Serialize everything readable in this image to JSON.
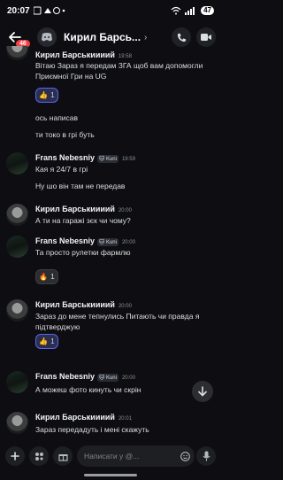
{
  "status_bar": {
    "time": "20:07",
    "battery": "47"
  },
  "header": {
    "back_badge": "46",
    "title": "Кирил Барсь...",
    "chevron": "›"
  },
  "messages": [
    {
      "id": "m1",
      "author": "Кирил Барськиииий",
      "time": "19:58",
      "avatar": "kyryl",
      "lines": [
        "Вітаю Зараз я передам ЗГА щоб вам допомогли Приємної Гри на UG"
      ],
      "reaction": {
        "emoji": "👍",
        "count": "1"
      }
    },
    {
      "id": "m2",
      "lines": [
        "ось написав"
      ]
    },
    {
      "id": "m3",
      "lines": [
        "ти токо в грі буть"
      ]
    },
    {
      "id": "m4",
      "author": "Frans Nebesniy",
      "tag": "Kuni",
      "time": "19:59",
      "avatar": "frans",
      "lines": [
        "Кая я 24/7 в грі"
      ]
    },
    {
      "id": "m5",
      "lines": [
        "Ну шо він там не передав"
      ]
    },
    {
      "id": "m6",
      "author": "Кирил Барськиииий",
      "time": "20:00",
      "avatar": "kyryl",
      "lines": [
        "А ти на гаражі зєк чи чому?"
      ]
    },
    {
      "id": "m7",
      "author": "Frans Nebesniy",
      "tag": "Kuni",
      "time": "20:00",
      "avatar": "frans",
      "lines": [
        "Та просто рулетки фармлю"
      ],
      "reaction": {
        "emoji": "🔥",
        "count": "1"
      }
    },
    {
      "id": "m8",
      "author": "Кирил Барськиииий",
      "time": "20:00",
      "avatar": "kyryl",
      "lines": [
        "Зараз до мене тепнулись Питають чи правда я підтверджую"
      ],
      "reaction": {
        "emoji": "👍",
        "count": "1"
      }
    },
    {
      "id": "m9",
      "author": "Frans Nebesniy",
      "tag": "Kuni",
      "time": "20:00",
      "avatar": "frans",
      "lines": [
        "А можеш фото кинуть чи скрін"
      ]
    },
    {
      "id": "m10",
      "author": "Кирил Барськиииий",
      "time": "20:01",
      "avatar": "kyryl",
      "lines": [
        "Зараз передадуть і мені скажуть"
      ]
    }
  ],
  "composer": {
    "placeholder": "Написати у @..."
  },
  "icons": {
    "back": "arrow-left-icon",
    "call": "phone-icon",
    "video": "video-camera-icon",
    "scroll_down": "arrow-down-icon",
    "add": "plus-icon",
    "apps": "apps-icon",
    "gift": "gift-icon",
    "emoji": "smile-icon",
    "mic": "microphone-icon"
  },
  "colors": {
    "accent": "#5865f2",
    "badge": "#f23f43",
    "background": "#0e0e12"
  }
}
